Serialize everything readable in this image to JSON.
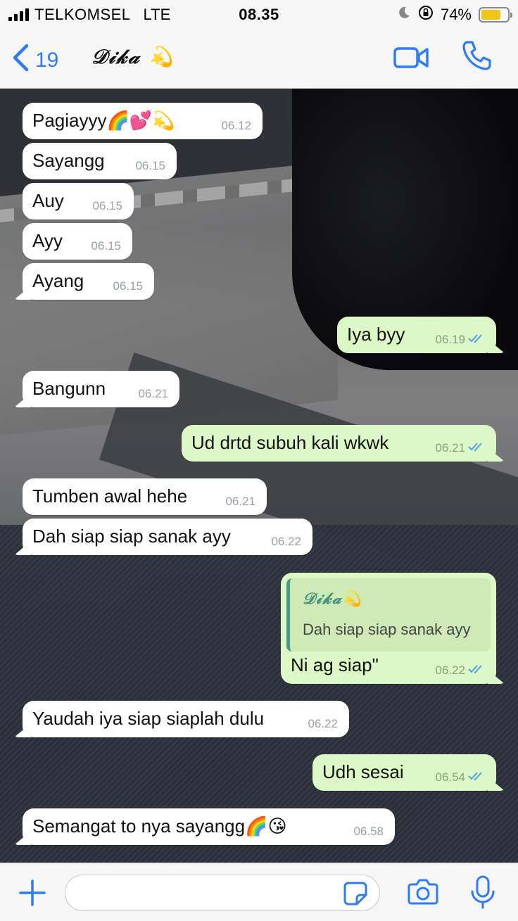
{
  "status_bar": {
    "carrier": "TELKOMSEL",
    "network": "LTE",
    "time": "08.35",
    "battery_percent": "74%",
    "battery_level": 0.74,
    "icons": [
      "signal-icon",
      "moon-icon",
      "rotation-lock-icon",
      "battery-icon"
    ]
  },
  "nav": {
    "back_count": "19",
    "contact_name": "𝒟𝒾𝓀𝒶",
    "icons": [
      "back-chevron-icon",
      "sparkle-emoji-icon",
      "video-call-icon",
      "voice-call-icon"
    ],
    "accent_color": "#2f7cf6"
  },
  "messages": [
    {
      "dir": "in",
      "text": "Pagiayyy🌈💕💫",
      "time": "06.12"
    },
    {
      "dir": "in",
      "text": "Sayangg",
      "time": "06.15"
    },
    {
      "dir": "in",
      "text": "Auy",
      "time": "06.15"
    },
    {
      "dir": "in",
      "text": "Ayy",
      "time": "06.15"
    },
    {
      "dir": "in",
      "text": "Ayang",
      "time": "06.15"
    },
    {
      "dir": "out",
      "text": "Iya byy",
      "time": "06.19",
      "status": "read"
    },
    {
      "dir": "in",
      "text": "Bangunn",
      "time": "06.21"
    },
    {
      "dir": "out",
      "text": "Ud drtd subuh kali wkwk",
      "time": "06.21",
      "status": "read"
    },
    {
      "dir": "in",
      "text": "Tumben awal hehe",
      "time": "06.21"
    },
    {
      "dir": "in",
      "text": "Dah siap siap sanak ayy",
      "time": "06.22"
    },
    {
      "dir": "out",
      "text": "Ni ag siap\"",
      "time": "06.22",
      "status": "read",
      "reply_to": {
        "name": "𝒟𝒾𝓀𝒶",
        "text": "Dah siap siap sanak ayy"
      }
    },
    {
      "dir": "in",
      "text": "Yaudah iya siap siaplah dulu",
      "time": "06.22"
    },
    {
      "dir": "out",
      "text": "Udh sesai",
      "time": "06.54",
      "status": "read"
    },
    {
      "dir": "in",
      "text": "Semangat to nya sayangg🌈😘",
      "time": "06.58"
    }
  ],
  "colors": {
    "incoming_bubble": "#ffffff",
    "outgoing_bubble": "#dcf8c6",
    "read_ticks": "#4fa3e0",
    "reply_bar": "#4a9a86"
  },
  "input_bar": {
    "placeholder": "",
    "icons": [
      "plus-icon",
      "sticker-icon",
      "camera-icon",
      "microphone-icon"
    ]
  }
}
